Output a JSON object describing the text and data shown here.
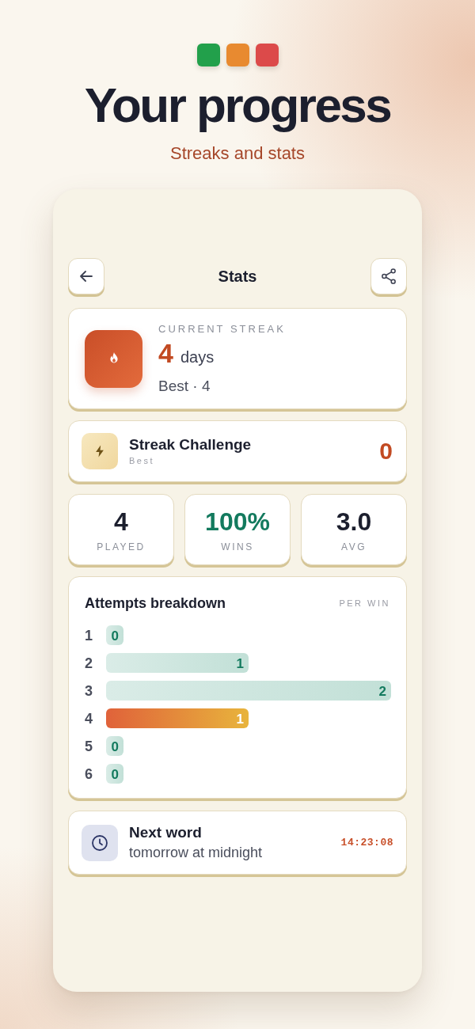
{
  "logo_tiles": [
    {
      "color": "#22a04b"
    },
    {
      "color": "#e88a30"
    },
    {
      "color": "#dc4a4a"
    }
  ],
  "hero": {
    "title": "Your progress",
    "subtitle": "Streaks and stats"
  },
  "screen": {
    "title": "Stats",
    "current_streak": {
      "label": "CURRENT STREAK",
      "value": "4",
      "unit": "days",
      "best": "Best · 4"
    },
    "streak_challenge": {
      "title": "Streak Challenge",
      "subtitle": "Best",
      "value": "0"
    },
    "stats": [
      {
        "value": "4",
        "label": "PLAYED",
        "kind": "plain"
      },
      {
        "value": "100%",
        "label": "WINS",
        "kind": "positive"
      },
      {
        "value": "3.0",
        "label": "AVG",
        "kind": "plain"
      }
    ],
    "attempts": {
      "title": "Attempts breakdown",
      "note": "PER WIN",
      "chart_data": {
        "type": "bar",
        "orientation": "horizontal",
        "stacked": true,
        "data_labels": true,
        "categories": [
          "1",
          "2",
          "3",
          "4",
          "5",
          "6"
        ],
        "series": [
          {
            "color": "#c2e0d7",
            "values": [
              0,
              1,
              2,
              null,
              0,
              0
            ]
          },
          {
            "color": "#e0623a",
            "values": [
              null,
              null,
              null,
              1,
              null,
              null
            ]
          }
        ]
      }
    },
    "next_word": {
      "title": "Next word",
      "subtitle": "tomorrow at midnight",
      "countdown": "14:23:08"
    }
  }
}
